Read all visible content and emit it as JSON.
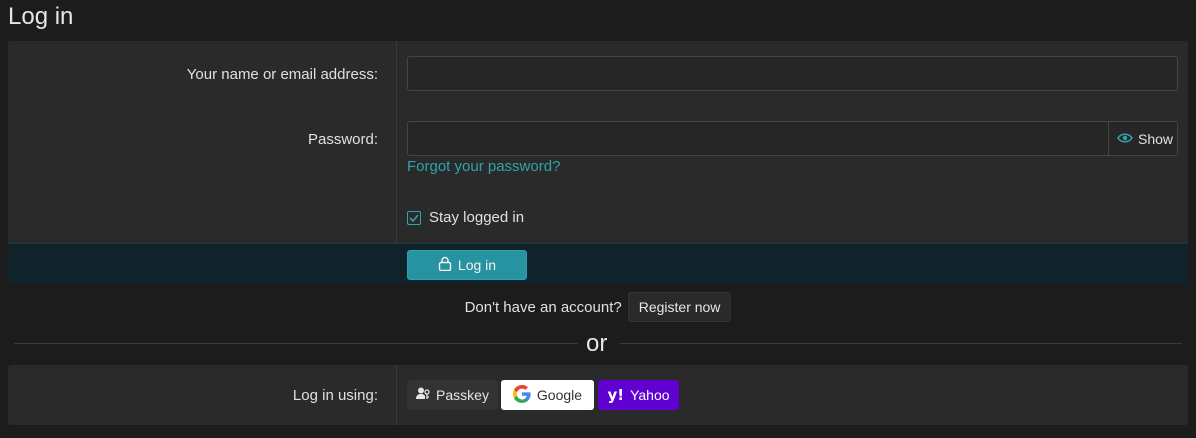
{
  "page": {
    "title": "Log in"
  },
  "form": {
    "username_label": "Your name or email address:",
    "username_value": "",
    "password_label": "Password:",
    "password_value": "",
    "show_label": "Show",
    "forgot_link": "Forgot your password?",
    "stay_label": "Stay logged in",
    "stay_checked": true,
    "submit_label": "Log in"
  },
  "register": {
    "prompt": "Don't have an account?",
    "button_label": "Register now"
  },
  "divider": {
    "text": "or"
  },
  "oauth": {
    "label": "Log in using:",
    "providers": [
      {
        "name": "Passkey",
        "icon": "passkey-icon"
      },
      {
        "name": "Google",
        "icon": "google-icon"
      },
      {
        "name": "Yahoo",
        "icon": "yahoo-icon"
      }
    ]
  },
  "colors": {
    "accent": "#2fa3ad",
    "button": "#2793a0",
    "yahoo": "#5f01d1"
  }
}
